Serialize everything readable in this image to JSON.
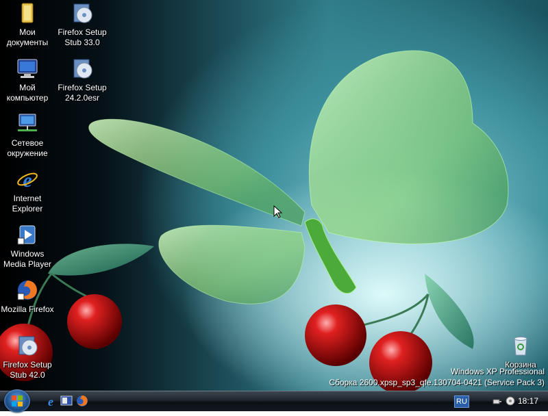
{
  "desktop": {
    "icons": [
      {
        "label": "Мои документы",
        "icon": "folder-icon"
      },
      {
        "label": "Firefox Setup Stub 33.0",
        "icon": "setup-cd-icon"
      },
      {
        "label": "Мой компьютер",
        "icon": "computer-icon"
      },
      {
        "label": "Firefox Setup 24.2.0esr",
        "icon": "setup-cd-icon"
      },
      {
        "label": "Сетевое окружение",
        "icon": "network-icon"
      },
      {
        "label": "Internet Explorer",
        "icon": "ie-icon"
      },
      {
        "label": "Windows Media Player",
        "icon": "media-player-icon"
      },
      {
        "label": "Mozilla Firefox",
        "icon": "firefox-icon"
      },
      {
        "label": "Firefox Setup Stub 42.0",
        "icon": "setup-cd-icon"
      },
      {
        "label": "Корзина",
        "icon": "recycle-bin-icon"
      }
    ],
    "watermark": {
      "line1": "Windows XP Professional",
      "line2": "Сборка 2600.xpsp_sp3_qfe.130704-0421 (Service Pack 3)"
    }
  },
  "taskbar": {
    "language": "RU",
    "clock": "18:17",
    "quick_launch": [
      "ie-icon",
      "desktop-icon",
      "firefox-icon"
    ]
  },
  "colors": {
    "taskbar": "#1e252c",
    "lang_badge": "#2a5ea8"
  }
}
